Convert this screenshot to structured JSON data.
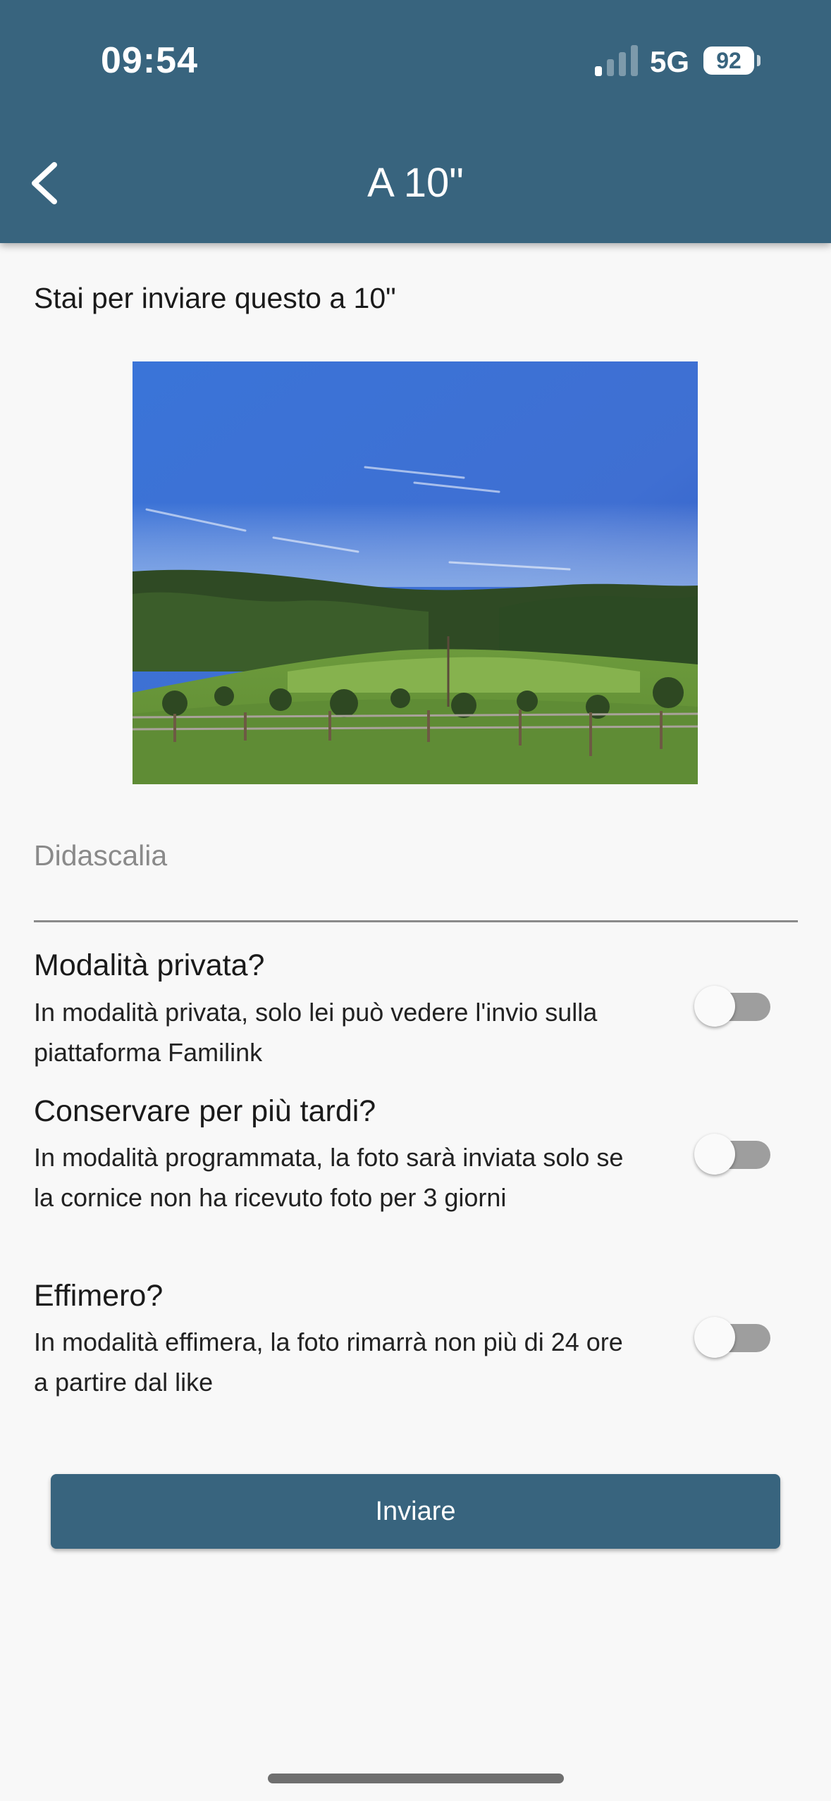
{
  "status_bar": {
    "time": "09:54",
    "network": "5G",
    "battery": "92",
    "signal_bars_active": 1,
    "signal_bars_total": 4
  },
  "header": {
    "title": "A 10\"",
    "back_icon": "chevron-left-icon",
    "background_color": "#38647e"
  },
  "intro_text": "Stai per inviare questo a 10\"",
  "caption": {
    "placeholder": "Didascalia",
    "value": ""
  },
  "options": [
    {
      "title": "Modalità privata?",
      "description": "In modalità privata, solo lei può vedere l'invio sulla piattaforma Familink",
      "enabled": false
    },
    {
      "title": "Conservare per più tardi?",
      "description": "In modalità programmata, la foto sarà inviata solo se la cornice non ha ricevuto foto per 3 giorni",
      "enabled": false
    },
    {
      "title": "Effimero?",
      "description": "In modalità effimera, la foto rimarrà non più di 24 ore a partire dal like",
      "enabled": false
    }
  ],
  "send_button": {
    "label": "Inviare"
  }
}
